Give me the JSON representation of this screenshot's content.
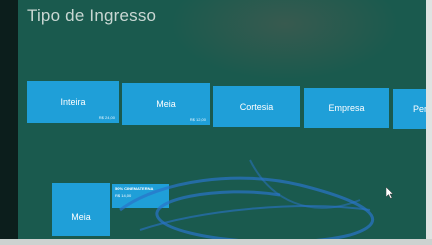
{
  "header": {
    "title": "Tipo de Ingresso"
  },
  "ticket_types": [
    {
      "label": "Inteira",
      "price": "R$ 24,00"
    },
    {
      "label": "Meia",
      "price": "R$ 12,00"
    },
    {
      "label": "Cortesia",
      "price": ""
    },
    {
      "label": "Empresa",
      "price": ""
    },
    {
      "label": "Per",
      "price": ""
    }
  ],
  "selection": {
    "tile_label": "Meia",
    "detail_name": "50% CINEMATERNA",
    "detail_price": "R$ 14,00"
  },
  "colors": {
    "tile": "#1f9fd8",
    "background": "#1a5a4e"
  }
}
